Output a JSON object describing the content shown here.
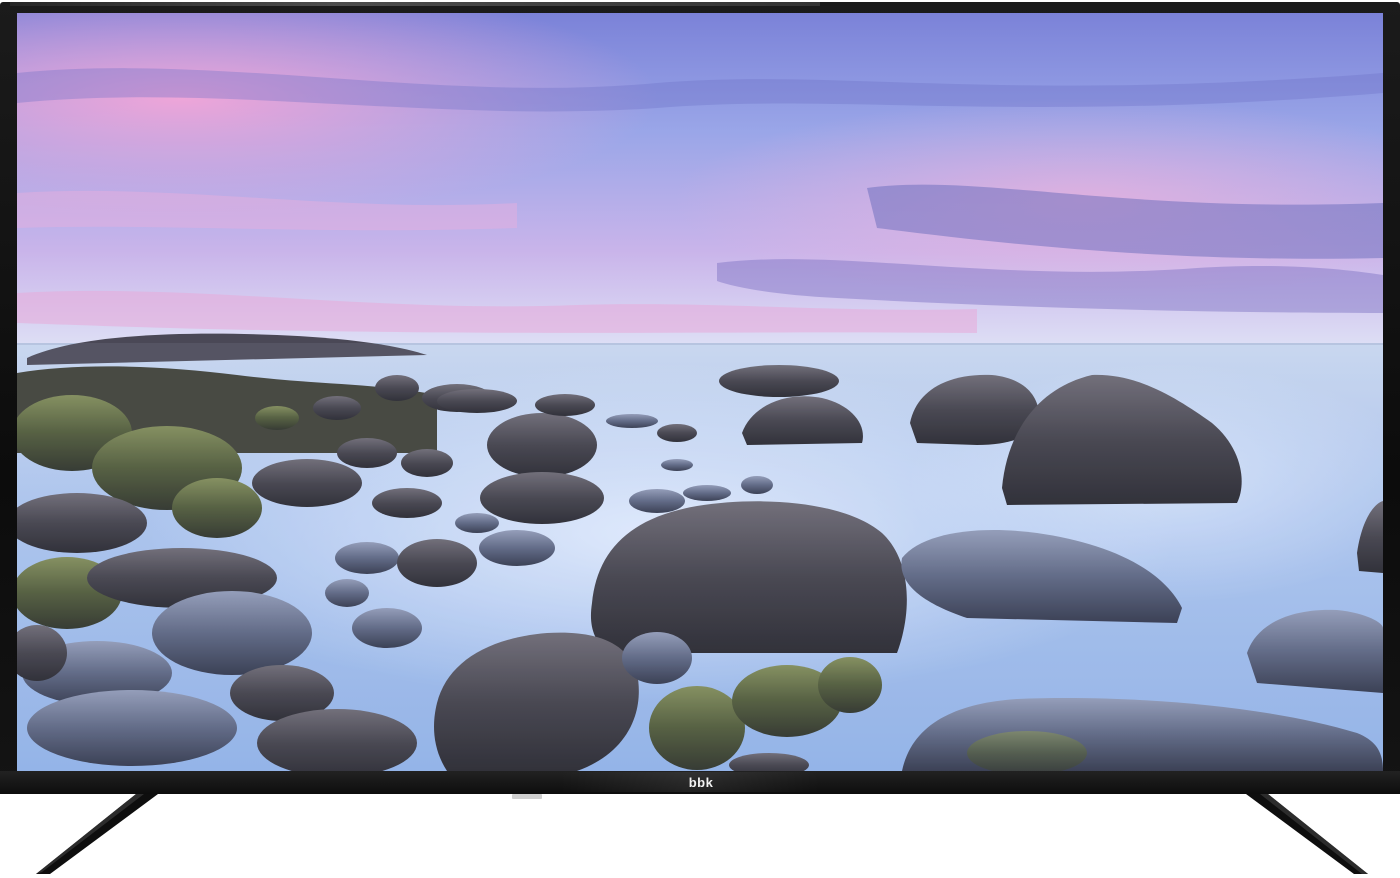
{
  "product": {
    "brand_logo": "bbk"
  },
  "screen": {
    "scene": "seascape",
    "colors": {
      "sky_top": "#8f9ee0",
      "sky_pink": "#e8b4df",
      "sea_mist": "#b8cff0",
      "rock_dark": "#3a3a42",
      "moss": "#5f6b3e"
    }
  },
  "frame": {
    "bezel_color": "#111111",
    "stand_color": "#0e0e0e",
    "sensor_color": "#cfcfcf"
  }
}
